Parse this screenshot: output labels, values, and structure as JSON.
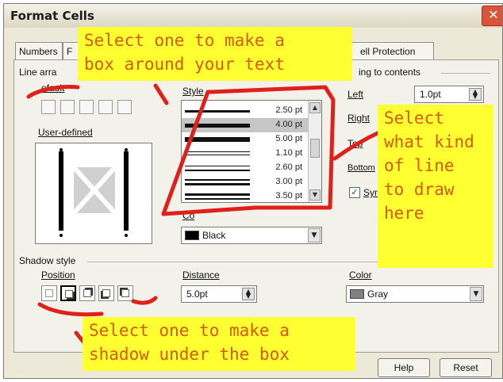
{
  "window": {
    "title": "Format Cells",
    "close_glyph": "✕"
  },
  "tabs": [
    "Numbers",
    "F",
    "ell Protection"
  ],
  "line_arrangement": {
    "header": "Line arra",
    "default_label": "efault",
    "user_defined_label": "User-defined"
  },
  "line": {
    "style_label": "Style",
    "styles": [
      {
        "label": "2.50 pt",
        "selected": false
      },
      {
        "label": "4.00 pt",
        "selected": true
      },
      {
        "label": "5.00 pt",
        "selected": false
      },
      {
        "label": "1.10 pt",
        "selected": false
      },
      {
        "label": "2.60 pt",
        "selected": false
      },
      {
        "label": "3.00 pt",
        "selected": false
      },
      {
        "label": "3.50 pt",
        "selected": false
      }
    ],
    "color_label": "Co",
    "color_value": "Black",
    "color_swatch": "#000000"
  },
  "spacing": {
    "header": "ing to contents",
    "left_label": "Left",
    "left_value": "1.0pt",
    "right_label": "Right",
    "top_label": "Top",
    "bottom_label": "Bottom",
    "sync_label": "Syn",
    "sync_checked": true
  },
  "shadow": {
    "header": "Shadow style",
    "position_label": "Position",
    "distance_label": "Distance",
    "distance_value": "5.0pt",
    "color_label": "Color",
    "color_value": "Gray",
    "color_swatch": "#808080",
    "selected_position": 1
  },
  "buttons": {
    "help": "Help",
    "reset": "Reset"
  },
  "annotations": {
    "top": [
      "Select one to make a",
      "box around your text"
    ],
    "right": [
      "Select",
      "what kind",
      "of line",
      "to draw",
      "here"
    ],
    "bottom": [
      "Select one to make a",
      "shadow under the box"
    ]
  },
  "colors": {
    "annotation_bg": "#ffff32",
    "annotation_text": "#d75a00",
    "scribble": "#e0201a"
  }
}
